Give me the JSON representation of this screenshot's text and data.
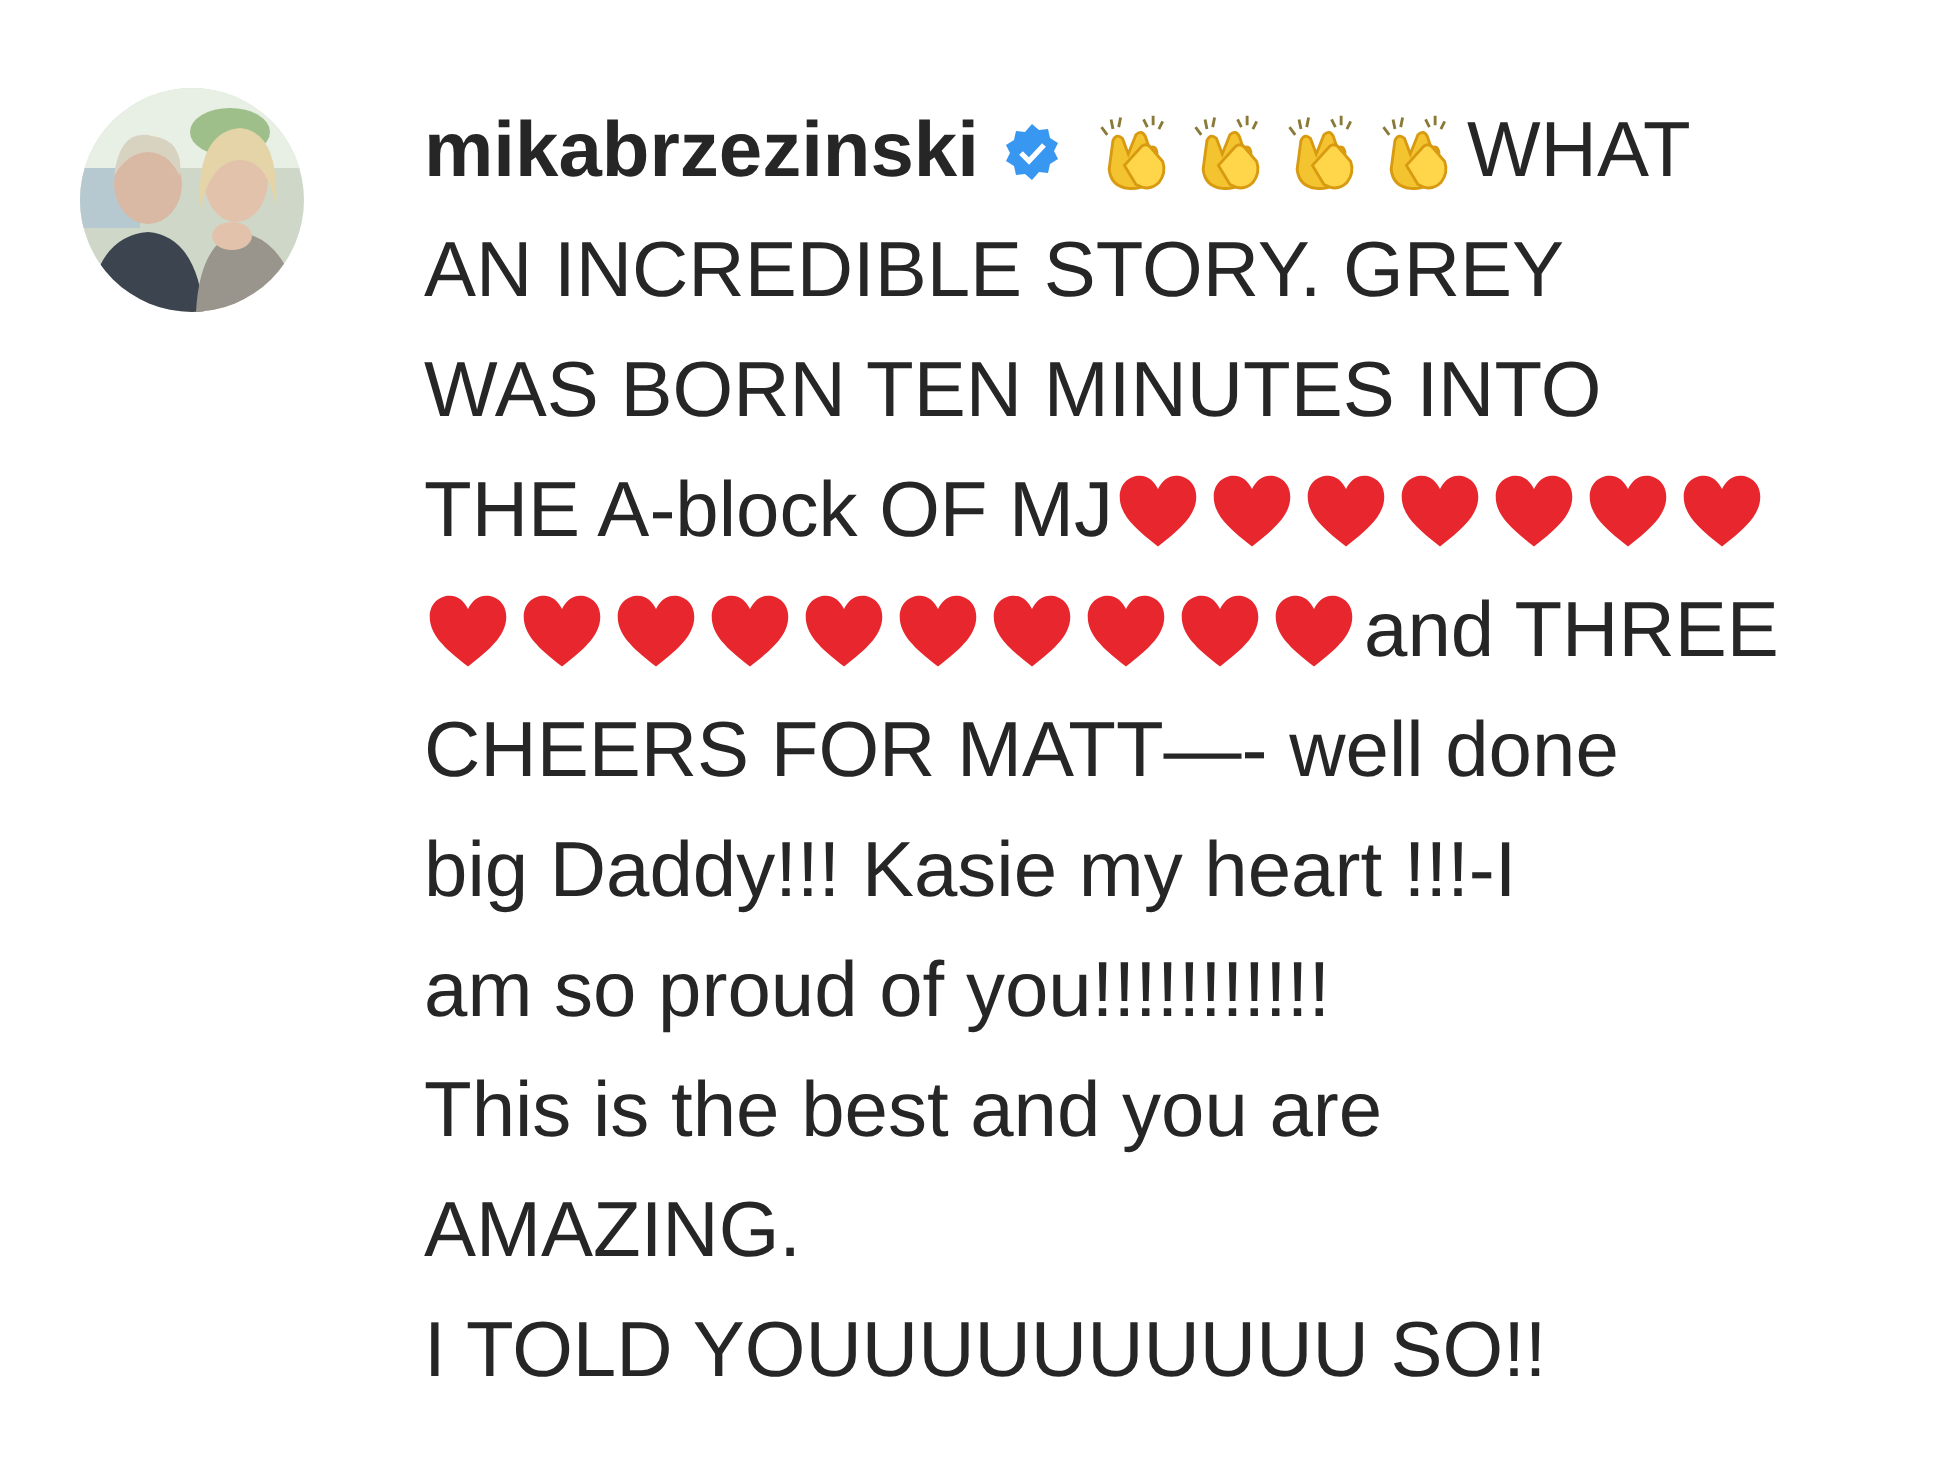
{
  "comment": {
    "username": "mikabrzezinski",
    "verified": true,
    "lines": [
      {
        "segments": [
          {
            "kind": "clap"
          },
          {
            "kind": "clap"
          },
          {
            "kind": "clap"
          },
          {
            "kind": "clap"
          },
          {
            "kind": "text",
            "text": "WHAT"
          }
        ]
      },
      {
        "segments": [
          {
            "kind": "text",
            "text": "AN INCREDIBLE STORY. GREY"
          }
        ]
      },
      {
        "segments": [
          {
            "kind": "text",
            "text": "WAS BORN TEN MINUTES INTO"
          }
        ]
      },
      {
        "segments": [
          {
            "kind": "text",
            "text": "THE A-block OF MJ"
          },
          {
            "kind": "heart"
          },
          {
            "kind": "heart"
          },
          {
            "kind": "heart"
          },
          {
            "kind": "heart"
          },
          {
            "kind": "heart"
          },
          {
            "kind": "heart"
          },
          {
            "kind": "heart"
          }
        ]
      },
      {
        "segments": [
          {
            "kind": "heart"
          },
          {
            "kind": "heart"
          },
          {
            "kind": "heart"
          },
          {
            "kind": "heart"
          },
          {
            "kind": "heart"
          },
          {
            "kind": "heart"
          },
          {
            "kind": "heart"
          },
          {
            "kind": "heart"
          },
          {
            "kind": "heart"
          },
          {
            "kind": "heart"
          },
          {
            "kind": "text",
            "text": "and THREE"
          }
        ]
      },
      {
        "segments": [
          {
            "kind": "text",
            "text": "CHEERS FOR MATT—- well done"
          }
        ]
      },
      {
        "segments": [
          {
            "kind": "text",
            "text": "big Daddy!!! Kasie my heart !!!-I"
          }
        ]
      },
      {
        "segments": [
          {
            "kind": "text",
            "text": "am so proud of you!!!!!!!!!!!"
          }
        ]
      },
      {
        "segments": [
          {
            "kind": "text",
            "text": "This is the best and you are"
          }
        ]
      },
      {
        "segments": [
          {
            "kind": "text",
            "text": "AMAZING."
          }
        ]
      },
      {
        "segments": [
          {
            "kind": "text",
            "text": "I TOLD YOUUUUUUUUUU SO!!"
          }
        ]
      }
    ]
  }
}
